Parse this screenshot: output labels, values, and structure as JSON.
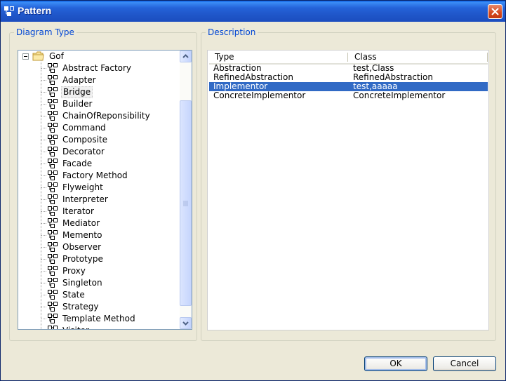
{
  "window": {
    "title": "Pattern"
  },
  "diagram_type": {
    "group_title": "Diagram Type",
    "root": {
      "label": "Gof",
      "expanded": true,
      "icon": "folder-icon"
    },
    "items": [
      "Abstract Factory",
      "Adapter",
      "Bridge",
      "Builder",
      "ChainOfReponsibility",
      "Command",
      "Composite",
      "Decorator",
      "Facade",
      "Factory Method",
      "Flyweight",
      "Interpreter",
      "Iterator",
      "Mediator",
      "Memento",
      "Observer",
      "Prototype",
      "Proxy",
      "Singleton",
      "State",
      "Strategy",
      "Template Method",
      "Visitor"
    ],
    "selected_index": 2
  },
  "description": {
    "group_title": "Description",
    "columns": [
      "Type",
      "Class"
    ],
    "rows": [
      {
        "type": "Abstraction",
        "class": "test,Class"
      },
      {
        "type": "RefinedAbstraction",
        "class": "RefinedAbstraction"
      },
      {
        "type": "Implementor",
        "class": "test,aaaaa"
      },
      {
        "type": "ConcreteImplementor",
        "class": "ConcreteImplementor"
      }
    ],
    "selected_row": 2
  },
  "buttons": {
    "ok": "OK",
    "cancel": "Cancel"
  },
  "colors": {
    "titlebar": "#1f55c8",
    "selection": "#316ac5",
    "group_title": "#0046d5"
  }
}
